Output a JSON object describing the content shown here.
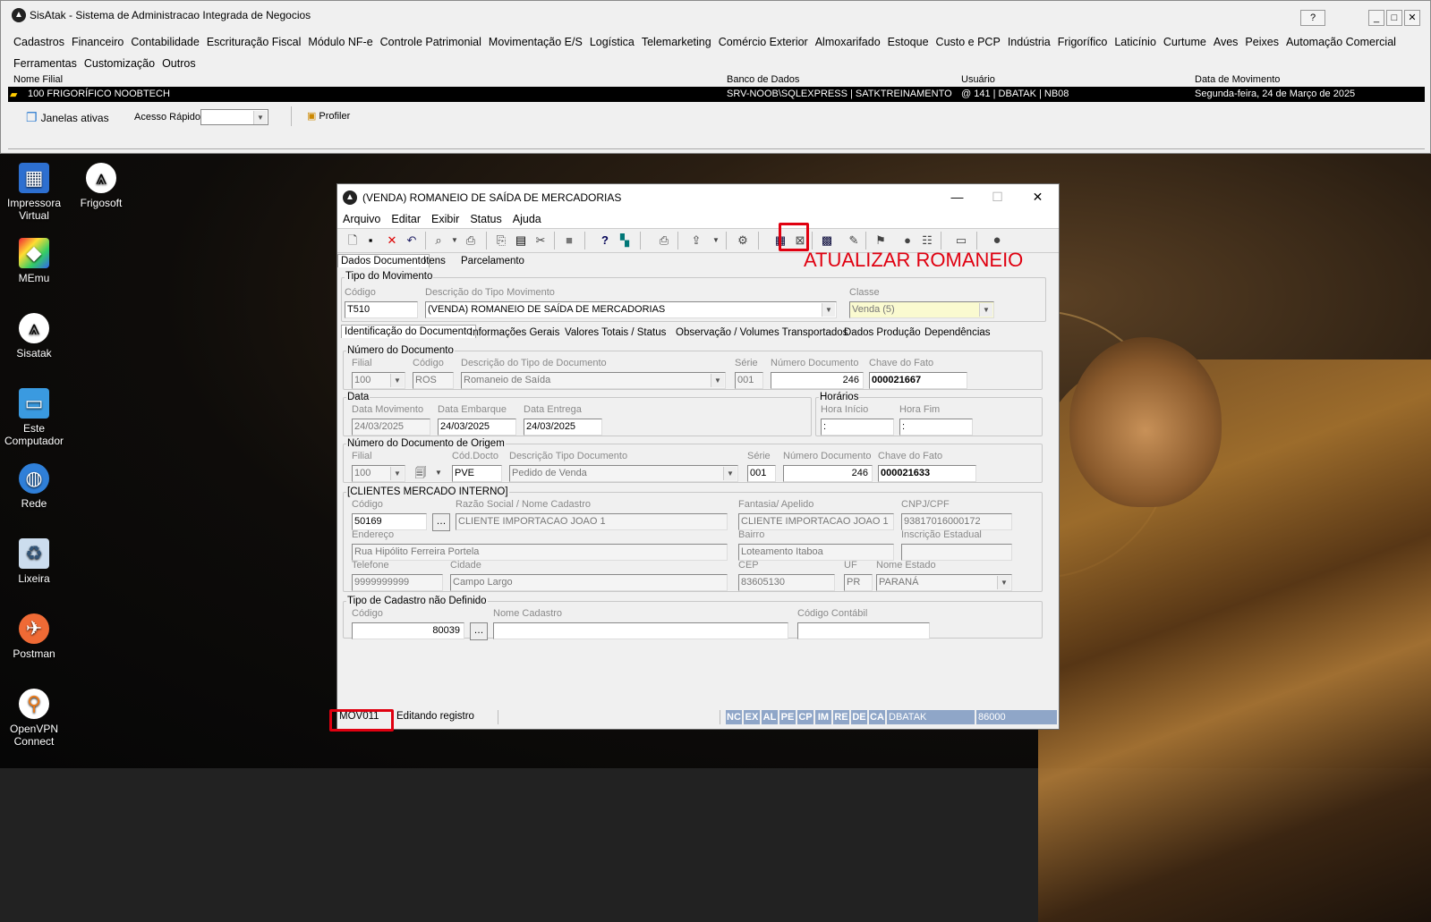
{
  "app": {
    "title": "SisAtak - Sistema de Administracao Integrada de Negocios",
    "help": "?",
    "minimize": "_",
    "maximize": "□",
    "close": "✕"
  },
  "menu": [
    "Cadastros",
    "Financeiro",
    "Contabilidade",
    "Escrituração Fiscal",
    "Módulo NF-e",
    "Controle Patrimonial",
    "Movimentação E/S",
    "Logística",
    "Telemarketing",
    "Comércio Exterior",
    "Almoxarifado",
    "Estoque",
    "Custo e PCP",
    "Indústria",
    "Frigorífico",
    "Laticínio",
    "Curtume",
    "Aves",
    "Peixes",
    "Automação Comercial",
    "Ferramentas",
    "Customização",
    "Outros"
  ],
  "info": {
    "h_filial": "Nome Filial",
    "h_banco": "Banco de Dados",
    "h_usuario": "Usuário",
    "h_data": "Data de Movimento",
    "filial": "100 FRIGORÍFICO NOOBTECH",
    "banco": "SRV-NOOB\\SQLEXPRESS | SATKTREINAMENTO",
    "usuario": "@ 141 | DBATAK | NB08",
    "data": "Segunda-feira, 24 de Março de 2025"
  },
  "toolbar": {
    "janelas": "Janelas ativas",
    "acesso": "Acesso Rápido",
    "profiler": "Profiler"
  },
  "desktop": [
    {
      "label": "Impressora Virtual",
      "icon": "printer-icon"
    },
    {
      "label": "Frigosoft",
      "icon": "frigosoft-icon"
    },
    {
      "label": "MEmu",
      "icon": "memu-icon"
    },
    {
      "label": "Sisatak",
      "icon": "sisatak-icon"
    },
    {
      "label": "Este Computador",
      "icon": "computer-icon"
    },
    {
      "label": "Rede",
      "icon": "network-icon"
    },
    {
      "label": "Lixeira",
      "icon": "recycle-bin-icon"
    },
    {
      "label": "Postman",
      "icon": "postman-icon"
    },
    {
      "label": "OpenVPN Connect",
      "icon": "openvpn-icon"
    }
  ],
  "win": {
    "title": "(VENDA) ROMANEIO DE SAÍDA DE MERCADORIAS",
    "menu": [
      "Arquivo",
      "Editar",
      "Exibir",
      "Status",
      "Ajuda"
    ],
    "annotation": "ATUALIZAR ROMANEIO",
    "tabs": [
      "Dados Documento",
      "Itens",
      "Parcelamento"
    ],
    "tipo": {
      "group": "Tipo do Movimento",
      "l_codigo": "Código",
      "l_desc": "Descrição do Tipo Movimento",
      "l_classe": "Classe",
      "codigo": "T510",
      "desc": "(VENDA) ROMANEIO DE SAÍDA DE MERCADORIAS",
      "classe": "Venda (5)"
    },
    "subtabs": [
      "Identificação do Documento",
      "Informações Gerais",
      "Valores Totais / Status",
      "Observação / Volumes Transportados",
      "Dados Produção",
      "Dependências"
    ],
    "numdoc": {
      "group": "Número do Documento",
      "l_filial": "Filial",
      "l_codigo": "Código",
      "l_desc": "Descrição do Tipo de Documento",
      "l_serie": "Série",
      "l_num": "Número Documento",
      "l_chave": "Chave do Fato",
      "filial": "100",
      "codigo": "ROS",
      "desc": "Romaneio de Saída",
      "serie": "001",
      "num": "246",
      "chave": "000021667"
    },
    "data": {
      "group": "Data",
      "l_mov": "Data Movimento",
      "l_emb": "Data Embarque",
      "l_ent": "Data Entrega",
      "mov": "24/03/2025",
      "emb": "24/03/2025",
      "ent": "24/03/2025"
    },
    "hor": {
      "group": "Horários",
      "l_ini": "Hora Início",
      "l_fim": "Hora Fim",
      "ini": ":",
      "fim": ":"
    },
    "origem": {
      "group": "Número do Documento de Origem",
      "l_filial": "Filial",
      "l_cod": "Cód.Docto",
      "l_desc": "Descrição Tipo Documento",
      "l_serie": "Série",
      "l_num": "Número Documento",
      "l_chave": "Chave do Fato",
      "filial": "100",
      "cod": "PVE",
      "desc": "Pedido de Venda",
      "serie": "001",
      "num": "246",
      "chave": "000021633"
    },
    "cli": {
      "group": "[CLIENTES MERCADO INTERNO]",
      "l_codigo": "Código",
      "l_razao": "Razão Social / Nome Cadastro",
      "l_fantasia": "Fantasia/ Apelido",
      "l_cnpj": "CNPJ/CPF",
      "l_end": "Endereço",
      "l_bairro": "Bairro",
      "l_ie": "Inscrição Estadual",
      "l_tel": "Telefone",
      "l_cidade": "Cidade",
      "l_cep": "CEP",
      "l_uf": "UF",
      "l_estado": "Nome Estado",
      "codigo": "50169",
      "razao": "CLIENTE IMPORTACAO JOAO 1",
      "fantasia": "CLIENTE IMPORTACAO JOAO 1",
      "cnpj": "93817016000172",
      "end": "Rua Hipólito Ferreira Portela",
      "bairro": "Loteamento Itaboa",
      "ie": "",
      "tel": "9999999999",
      "cidade": "Campo Largo",
      "cep": "83605130",
      "uf": "PR",
      "estado": "PARANÁ"
    },
    "cad": {
      "group": "Tipo de Cadastro não Definido",
      "l_codigo": "Código",
      "l_nome": "Nome Cadastro",
      "l_contabil": "Código Contábil",
      "codigo": "80039",
      "nome": "",
      "contabil": ""
    },
    "status": {
      "prog": "MOV011",
      "msg": "Editando registro",
      "keys": [
        "NC",
        "EX",
        "AL",
        "PE",
        "CP",
        "IM",
        "RE",
        "DE",
        "CA"
      ],
      "db": "DBATAK",
      "num": "86000"
    }
  }
}
